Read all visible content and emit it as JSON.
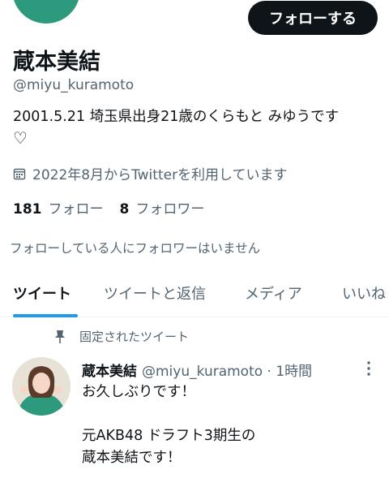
{
  "profile": {
    "follow_button": "フォローする",
    "display_name": "蔵本美結",
    "handle": "@miyu_kuramoto",
    "bio": "2001.5.21 埼玉県出身21歳のくらもと みゆうです",
    "bio_heart": "♡",
    "joined": "2022年8月からTwitterを利用しています",
    "following_count": "181",
    "following_label": "フォロー",
    "followers_count": "8",
    "followers_label": "フォロワー",
    "mutual_notice": "フォローしている人にフォロワーはいません"
  },
  "tabs": [
    {
      "label": "ツイート"
    },
    {
      "label": "ツイートと返信"
    },
    {
      "label": "メディア"
    },
    {
      "label": "いいね"
    }
  ],
  "tweet": {
    "pinned_label": "固定されたツイート",
    "author_name": "蔵本美結",
    "author_meta": "@miyu_kuramoto · 1時間",
    "text": "お久しぶりです！\n\n元AKB48 ドラフト3期生の\n蔵本美結です！"
  },
  "colors": {
    "accent": "#1d9bf0",
    "text": "#0f1419",
    "secondary": "#536471",
    "avatar_sweater": "#2e9a7d"
  },
  "icons": [
    "calendar-icon",
    "pin-icon",
    "more-dots-icon"
  ]
}
